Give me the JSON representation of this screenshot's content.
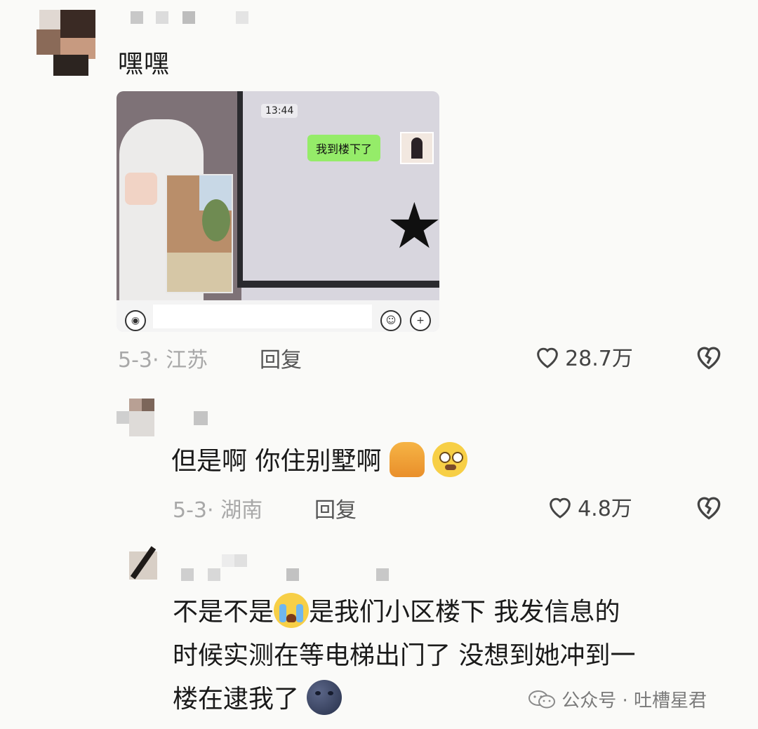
{
  "comment1": {
    "text": "嘿嘿",
    "screenshot": {
      "time": "13:44",
      "bubble": "我到楼下了",
      "voice_icon": "voice-icon",
      "emoji_icon": "smile-icon",
      "plus_icon": "plus-icon"
    },
    "date": "5-3",
    "sep": "·",
    "location": "江苏",
    "reply": "回复",
    "likes": "28.7万"
  },
  "comment2": {
    "text": "但是啊 你住别墅啊",
    "emojis": [
      "pray-emoji",
      "pleading-emoji"
    ],
    "date": "5-3",
    "sep": "·",
    "location": "湖南",
    "reply": "回复",
    "likes": "4.8万"
  },
  "comment3": {
    "line1a": "不是不是",
    "line1b": "是我们小区楼下  我发信息的",
    "line2": "时候实测在等电梯出门了  没想到她冲到一",
    "line3": "楼在逮我了",
    "emojis": [
      "crying-emoji",
      "new-moon-face-emoji"
    ]
  },
  "watermark": {
    "label": "公众号 · 吐槽星君",
    "icon": "wechat-icon"
  },
  "colors": {
    "bubble_green": "#95ec69",
    "meta_gray": "#a8a8a8"
  }
}
